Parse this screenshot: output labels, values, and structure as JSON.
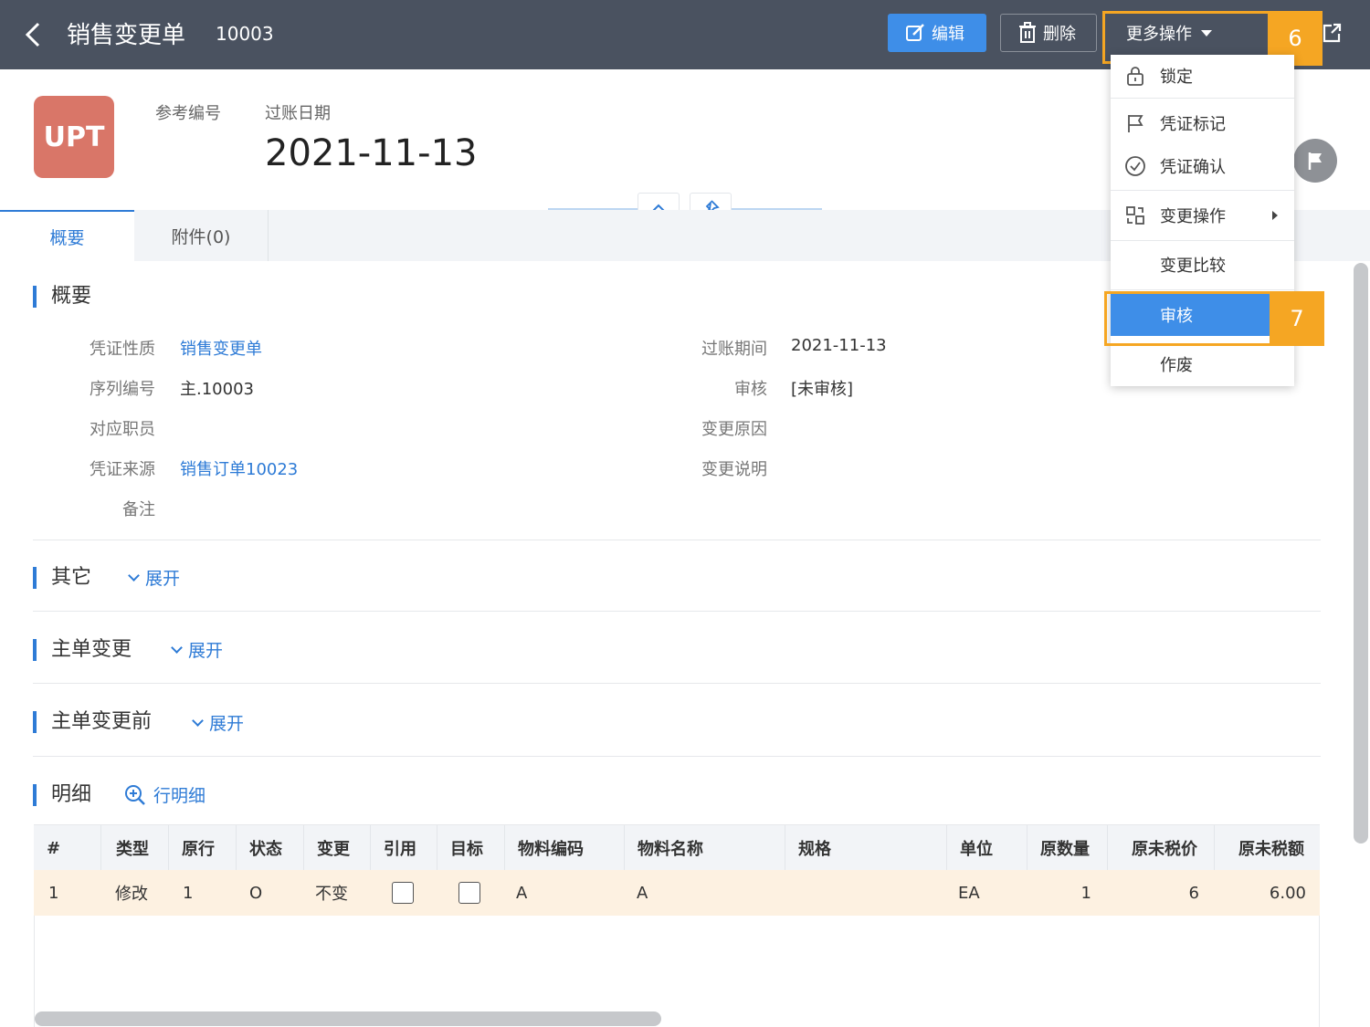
{
  "header": {
    "title": "销售变更单",
    "doc_number": "10003",
    "edit_label": "编辑",
    "delete_label": "删除",
    "more_label": "更多操作"
  },
  "callouts": {
    "more": "6",
    "audit": "7"
  },
  "record": {
    "avatar_text": "UPT",
    "ref_label": "参考编号",
    "date_label": "过账日期",
    "date_value": "2021-11-13"
  },
  "tabs": [
    {
      "label": "概要"
    },
    {
      "label": "附件(0)"
    }
  ],
  "overview": {
    "title": "概要",
    "left_fields": [
      {
        "label": "凭证性质",
        "value": "销售变更单"
      },
      {
        "label": "序列编号",
        "value": "主.10003"
      },
      {
        "label": "对应职员",
        "value": ""
      },
      {
        "label": "凭证来源",
        "value": "销售订单10023"
      },
      {
        "label": "备注",
        "value": ""
      }
    ],
    "right_fields": [
      {
        "label": "过账期间",
        "value": "2021-11-13"
      },
      {
        "label": "审核",
        "value": "[未审核]"
      },
      {
        "label": "变更原因",
        "value": ""
      },
      {
        "label": "变更说明",
        "value": ""
      }
    ]
  },
  "sections": [
    {
      "title": "其它",
      "expand": "展开"
    },
    {
      "title": "主单变更",
      "expand": "展开"
    },
    {
      "title": "主单变更前",
      "expand": "展开"
    }
  ],
  "detail": {
    "title": "明细",
    "add_label": "行明细",
    "columns": [
      "#",
      "类型",
      "原行",
      "状态",
      "变更",
      "引用",
      "目标",
      "物料编码",
      "物料名称",
      "规格",
      "单位",
      "原数量",
      "原未税价",
      "原未税额"
    ],
    "row": {
      "no": "1",
      "type": "修改",
      "orig_line": "1",
      "status": "O",
      "change": "不变",
      "ref_checked": false,
      "target_checked": false,
      "code": "A",
      "name": "A",
      "spec": "",
      "unit": "EA",
      "qty": "1",
      "price": "6",
      "amount": "6.00"
    }
  },
  "dropdown": {
    "items": [
      {
        "label": "锁定",
        "icon": "lock-icon"
      },
      {
        "label": "凭证标记",
        "icon": "flag-icon"
      },
      {
        "label": "凭证确认",
        "icon": "check-circle-icon"
      },
      {
        "label": "变更操作",
        "icon": "change-icon"
      },
      {
        "label": "变更比较"
      },
      {
        "label": "审核"
      },
      {
        "label": "作废"
      }
    ]
  }
}
